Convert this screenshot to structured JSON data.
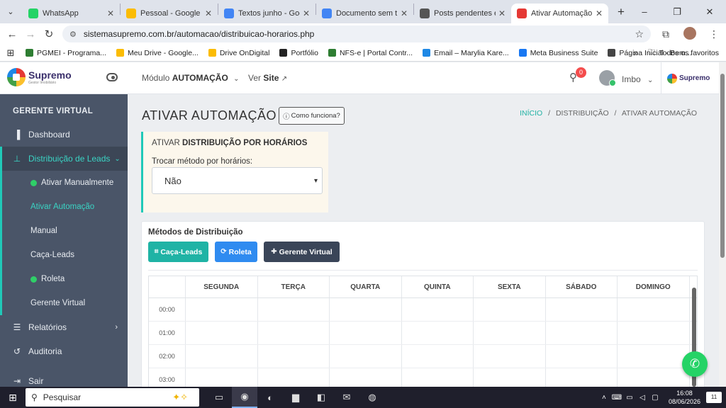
{
  "browser": {
    "tabs": [
      {
        "label": "WhatsApp",
        "icon": "whatsapp-icon",
        "color": "#25d366"
      },
      {
        "label": "Pessoal - Google Drive",
        "icon": "google-drive-icon",
        "color": "#fbbc04"
      },
      {
        "label": "Textos junho - Google Docs",
        "icon": "google-docs-icon",
        "color": "#4285f4"
      },
      {
        "label": "Documento sem título",
        "icon": "google-docs-icon",
        "color": "#4285f4"
      },
      {
        "label": "Posts pendentes em",
        "icon": "notion-icon",
        "color": "#555555"
      },
      {
        "label": "Ativar Automação - D",
        "icon": "supremo-icon",
        "color": "#e53935"
      }
    ],
    "url": "sistemasupremo.com.br/automacao/distribuicao-horarios.php",
    "bookmarks": [
      {
        "label": "PGMEI - Programa...",
        "color": "#2e7d32"
      },
      {
        "label": "Meu Drive - Google...",
        "color": "#fbbc04"
      },
      {
        "label": "Drive OnDigital",
        "color": "#fbbc04"
      },
      {
        "label": "Portfólio",
        "color": "#222222"
      },
      {
        "label": "NFS-e | Portal Contr...",
        "color": "#2e7d32"
      },
      {
        "label": "Email – Marylia Kare...",
        "color": "#1e88e5"
      },
      {
        "label": "Meta Business Suite",
        "color": "#1877f2"
      },
      {
        "label": "Página Inicial - Bem...",
        "color": "#444444"
      }
    ],
    "bookmarks_more": "»",
    "all_bookmarks": "Todos os favoritos"
  },
  "header": {
    "logo_title": "Supremo",
    "logo_sub": "Gestor Imobiliário",
    "module_prefix": "Módulo",
    "module_name": "AUTOMAÇÃO",
    "site_prefix": "Ver",
    "site_name": "Site",
    "notif_count": "0",
    "user_name": "Imbo",
    "brand_right": "Supremo"
  },
  "sidebar": {
    "section": "GERENTE VIRTUAL",
    "items": [
      {
        "label": "Dashboard"
      },
      {
        "label": "Distribuição de Leads"
      }
    ],
    "subitems": [
      {
        "label": "Ativar Manualmente",
        "dot": true
      },
      {
        "label": "Ativar Automação",
        "dot": false
      },
      {
        "label": "Manual",
        "dot": false
      },
      {
        "label": "Caça-Leads",
        "dot": false
      },
      {
        "label": "Roleta",
        "dot": true
      },
      {
        "label": "Gerente Virtual",
        "dot": false
      }
    ],
    "bottom": [
      {
        "label": "Relatórios"
      },
      {
        "label": "Auditoria"
      },
      {
        "label": "Sair"
      }
    ]
  },
  "main": {
    "title": "ATIVAR AUTOMAÇÃO",
    "how_button": "Como funciona?",
    "breadcrumb": [
      "INÍCIO",
      "DISTRIBUIÇÃO",
      "ATIVAR AUTOMAÇÃO"
    ],
    "breadcrumb_sep": "/",
    "card1_prefix": "ATIVAR",
    "card1_title": "DISTRIBUIÇÃO POR HORÁRIOS",
    "select_label": "Trocar método por horários:",
    "select_value": "Não",
    "methods_title": "Métodos de Distribuição",
    "method_buttons": [
      "Caça-Leads",
      "Roleta",
      "Gerente Virtual"
    ],
    "days": [
      "SEGUNDA",
      "TERÇA",
      "QUARTA",
      "QUINTA",
      "SEXTA",
      "SÁBADO",
      "DOMINGO"
    ],
    "times": [
      "00:00",
      "01:00",
      "02:00",
      "03:00"
    ]
  },
  "taskbar": {
    "search_placeholder": "Pesquisar",
    "time": "16:08",
    "date": "08/06/2026",
    "notif": "11"
  }
}
